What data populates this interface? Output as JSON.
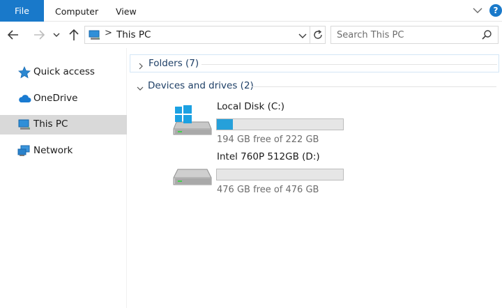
{
  "ribbon": {
    "tabs": [
      {
        "label": "File"
      },
      {
        "label": "Computer"
      },
      {
        "label": "View"
      }
    ],
    "help_label": "?"
  },
  "address_bar": {
    "separator": ">",
    "path": "This PC"
  },
  "search": {
    "placeholder": "Search This PC"
  },
  "nav_pane": {
    "items": [
      {
        "label": "Quick access",
        "icon": "star-icon"
      },
      {
        "label": "OneDrive",
        "icon": "cloud-icon"
      },
      {
        "label": "This PC",
        "icon": "computer-icon",
        "selected": true
      },
      {
        "label": "Network",
        "icon": "network-icon"
      }
    ]
  },
  "content": {
    "groups": [
      {
        "title": "Folders (7)",
        "expanded": false
      },
      {
        "title": "Devices and drives (2)",
        "expanded": true
      }
    ],
    "drives": [
      {
        "name": "Local Disk (C:)",
        "free_text": "194 GB free of 222 GB",
        "used_fraction": 0.126,
        "icon": "windows-drive-icon"
      },
      {
        "name": "Intel 760P 512GB (D:)",
        "free_text": "476 GB free of 476 GB",
        "used_fraction": 0.0,
        "icon": "hard-drive-icon"
      }
    ]
  },
  "colors": {
    "accent": "#1979ca",
    "selected_nav": "#d9d9d9",
    "usage_bar": "#26a0da",
    "group_title": "#1e3f66"
  }
}
